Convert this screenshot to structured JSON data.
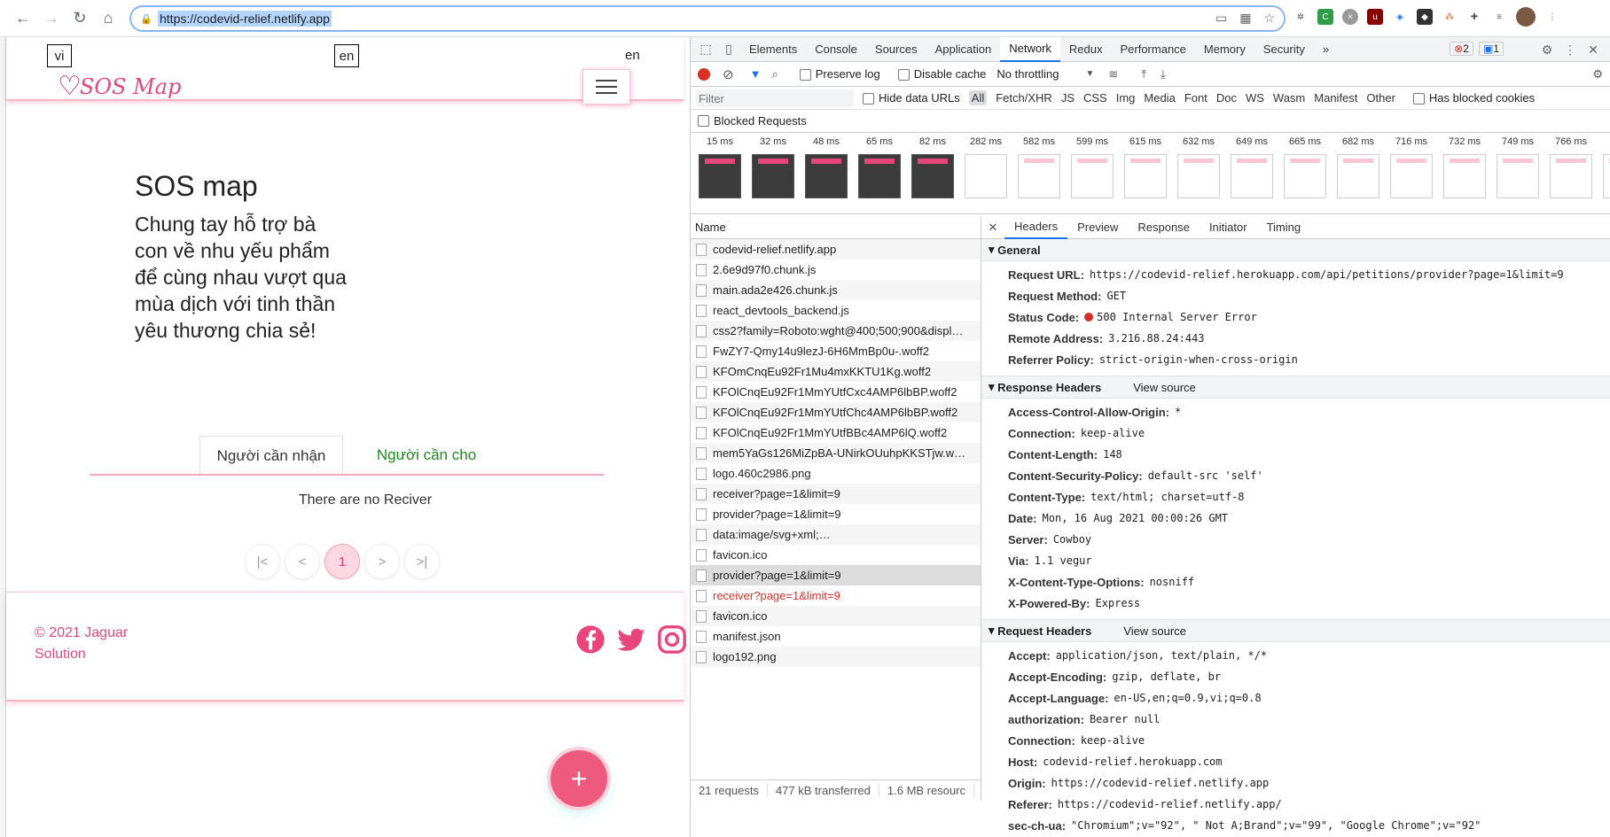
{
  "browser": {
    "url": "https://codevid-relief.netlify.app"
  },
  "app": {
    "lang_vi": "vi",
    "lang_en": "en",
    "lang_current": "en",
    "logo_text": "SOS Map",
    "hero_title": "SOS map",
    "hero_subtitle": "Chung tay hỗ trợ bà con về nhu yếu phẩm để cùng nhau vượt qua mùa dịch với tinh thần yêu thương chia sẻ!",
    "tabs": [
      "Người cần nhận",
      "Người cần cho"
    ],
    "empty_text": "There are no Reciver",
    "pager": {
      "first": "|<",
      "prev": "<",
      "current": "1",
      "next": ">",
      "last": ">|"
    },
    "copyright": "© 2021 Jaguar Solution",
    "fab": "+"
  },
  "devtools": {
    "tabs": [
      "Elements",
      "Console",
      "Sources",
      "Application",
      "Network",
      "Redux",
      "Performance",
      "Memory",
      "Security"
    ],
    "more": "»",
    "errors": "2",
    "messages": "1",
    "toolbar": {
      "preserve_log": "Preserve log",
      "disable_cache": "Disable cache",
      "throttling": "No throttling"
    },
    "filter": {
      "placeholder": "Filter",
      "hide_data_urls": "Hide data URLs",
      "types": [
        "All",
        "Fetch/XHR",
        "JS",
        "CSS",
        "Img",
        "Media",
        "Font",
        "Doc",
        "WS",
        "Wasm",
        "Manifest",
        "Other"
      ],
      "has_blocked_cookies": "Has blocked cookies",
      "blocked_requests": "Blocked Requests"
    },
    "filmstrip": [
      "15 ms",
      "32 ms",
      "48 ms",
      "65 ms",
      "82 ms",
      "282 ms",
      "582 ms",
      "599 ms",
      "615 ms",
      "632 ms",
      "649 ms",
      "665 ms",
      "682 ms",
      "716 ms",
      "732 ms",
      "749 ms",
      "766 ms",
      "7"
    ],
    "name_header": "Name",
    "requests": [
      "codevid-relief.netlify.app",
      "2.6e9d97f0.chunk.js",
      "main.ada2e426.chunk.js",
      "react_devtools_backend.js",
      "css2?family=Roboto:wght@400;500;900&displ…",
      "FwZY7-Qmy14u9lezJ-6H6MmBp0u-.woff2",
      "KFOmCnqEu92Fr1Mu4mxKKTU1Kg.woff2",
      "KFOlCnqEu92Fr1MmYUtfCxc4AMP6lbBP.woff2",
      "KFOlCnqEu92Fr1MmYUtfChc4AMP6lbBP.woff2",
      "KFOlCnqEu92Fr1MmYUtfBBc4AMP6lQ.woff2",
      "mem5YaGs126MiZpBA-UNirkOUuhpKKSTjw.w…",
      "logo.460c2986.png",
      "receiver?page=1&limit=9",
      "provider?page=1&limit=9",
      "data:image/svg+xml;…",
      "favicon.ico",
      "provider?page=1&limit=9",
      "receiver?page=1&limit=9",
      "favicon.ico",
      "manifest.json",
      "logo192.png"
    ],
    "status": {
      "requests": "21 requests",
      "transferred": "477 kB transferred",
      "resources": "1.6 MB resourc"
    },
    "detail_tabs": [
      "Headers",
      "Preview",
      "Response",
      "Initiator",
      "Timing"
    ],
    "general": {
      "title": "General",
      "rows": [
        {
          "k": "Request URL:",
          "v": "https://codevid-relief.herokuapp.com/api/petitions/provider?page=1&limit=9"
        },
        {
          "k": "Request Method:",
          "v": "GET"
        },
        {
          "k": "Status Code:",
          "v": "500 Internal Server Error"
        },
        {
          "k": "Remote Address:",
          "v": "3.216.88.24:443"
        },
        {
          "k": "Referrer Policy:",
          "v": "strict-origin-when-cross-origin"
        }
      ]
    },
    "response_headers": {
      "title": "Response Headers",
      "view_source": "View source",
      "rows": [
        {
          "k": "Access-Control-Allow-Origin:",
          "v": "*"
        },
        {
          "k": "Connection:",
          "v": "keep-alive"
        },
        {
          "k": "Content-Length:",
          "v": "148"
        },
        {
          "k": "Content-Security-Policy:",
          "v": "default-src 'self'"
        },
        {
          "k": "Content-Type:",
          "v": "text/html; charset=utf-8"
        },
        {
          "k": "Date:",
          "v": "Mon, 16 Aug 2021 00:00:26 GMT"
        },
        {
          "k": "Server:",
          "v": "Cowboy"
        },
        {
          "k": "Via:",
          "v": "1.1 vegur"
        },
        {
          "k": "X-Content-Type-Options:",
          "v": "nosniff"
        },
        {
          "k": "X-Powered-By:",
          "v": "Express"
        }
      ]
    },
    "request_headers": {
      "title": "Request Headers",
      "view_source": "View source",
      "rows": [
        {
          "k": "Accept:",
          "v": "application/json, text/plain, */*"
        },
        {
          "k": "Accept-Encoding:",
          "v": "gzip, deflate, br"
        },
        {
          "k": "Accept-Language:",
          "v": "en-US,en;q=0.9,vi;q=0.8"
        },
        {
          "k": "authorization:",
          "v": "Bearer null"
        },
        {
          "k": "Connection:",
          "v": "keep-alive"
        },
        {
          "k": "Host:",
          "v": "codevid-relief.herokuapp.com"
        },
        {
          "k": "Origin:",
          "v": "https://codevid-relief.netlify.app"
        },
        {
          "k": "Referer:",
          "v": "https://codevid-relief.netlify.app/"
        },
        {
          "k": "sec-ch-ua:",
          "v": "\"Chromium\";v=\"92\", \" Not A;Brand\";v=\"99\", \"Google Chrome\";v=\"92\""
        }
      ]
    }
  }
}
